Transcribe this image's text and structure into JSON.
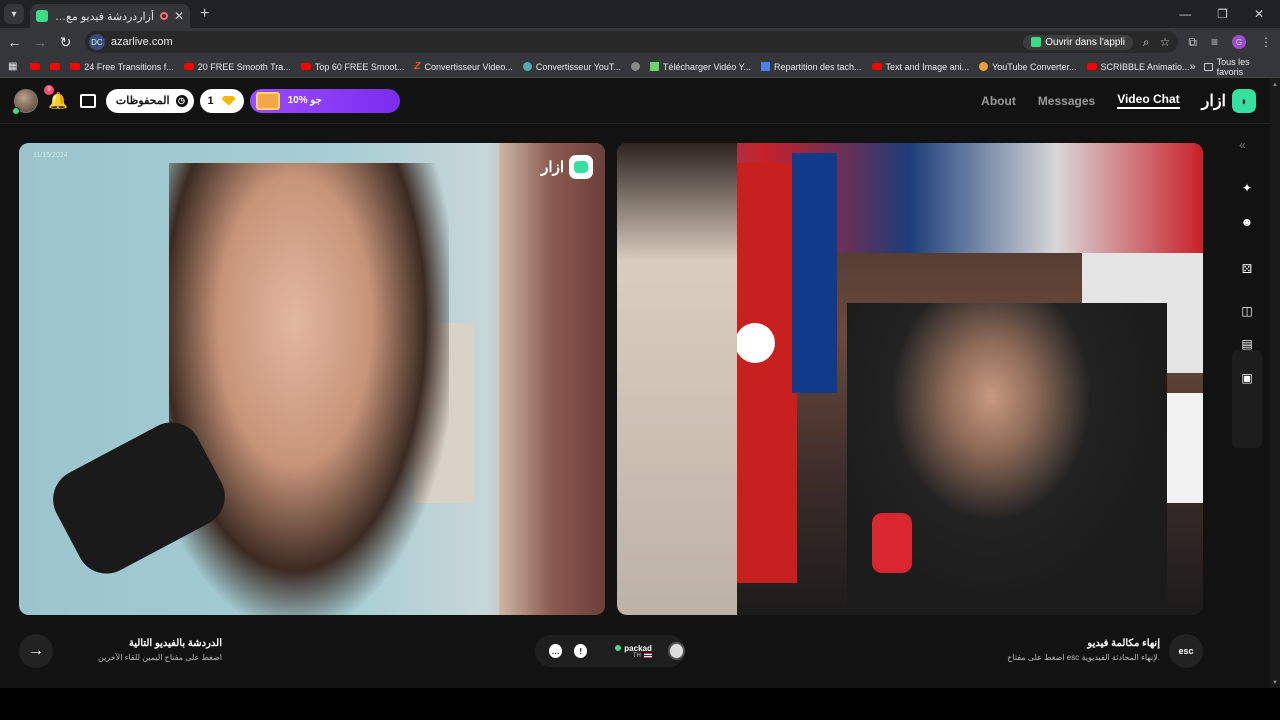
{
  "browser": {
    "tab_title": "أزاردردشة فيديو مع أشخاص.",
    "url": "azarlive.com",
    "site_badge": "DC",
    "open_app_label": "Ouvrir dans l'appli",
    "profile_initial": "G",
    "bookmarks": [
      {
        "icon": "youtube-icon",
        "label": ""
      },
      {
        "icon": "youtube-icon",
        "label": ""
      },
      {
        "icon": "youtube-icon",
        "label": "24 Free Transitions f..."
      },
      {
        "icon": "youtube-icon",
        "label": "20 FREE Smooth Tra..."
      },
      {
        "icon": "youtube-icon",
        "label": "Top 60 FREE Smoot..."
      },
      {
        "icon": "z-icon",
        "label": "Convertisseur Video..."
      },
      {
        "icon": "converter-icon",
        "label": "Convertisseur YouT..."
      },
      {
        "icon": "globe-icon",
        "label": ""
      },
      {
        "icon": "download-icon",
        "label": "Télécharger Vidéo Y..."
      },
      {
        "icon": "doc-icon",
        "label": "Repartition des tach..."
      },
      {
        "icon": "youtube-icon",
        "label": "Text and Image ani..."
      },
      {
        "icon": "fox-icon",
        "label": "YouTube Converter..."
      },
      {
        "icon": "youtube-icon",
        "label": "SCRIBBLE Animatio..."
      }
    ],
    "bookmarks_more": "»",
    "all_bookmarks_label": "Tous les favoris"
  },
  "header": {
    "notification_count": "9",
    "saved_label": "المحفوظات",
    "gems_count": "1",
    "promo_label": "10% جو",
    "nav": {
      "about": "About",
      "messages": "Messages",
      "video_chat": "Video Chat"
    },
    "brand": "ازار"
  },
  "videos": {
    "watermark_text": "ازار",
    "small_text": "11/15/2024"
  },
  "footer": {
    "next_title": "الدردشة بالفيديو التالية",
    "next_hint": "اضغط على مفتاح اليمين للقاء الآخرين",
    "partner_name": "packad",
    "partner_country": "TH",
    "end_title": "إنهاء مكالمة فيديو",
    "end_hint": "اضغط على مفتاح esc لإنهاء المحادثة الفيديوية.",
    "esc_label": "esc"
  },
  "colors": {
    "accent": "#35e0a1",
    "promo": "#8a3cf6",
    "background": "#121212"
  }
}
